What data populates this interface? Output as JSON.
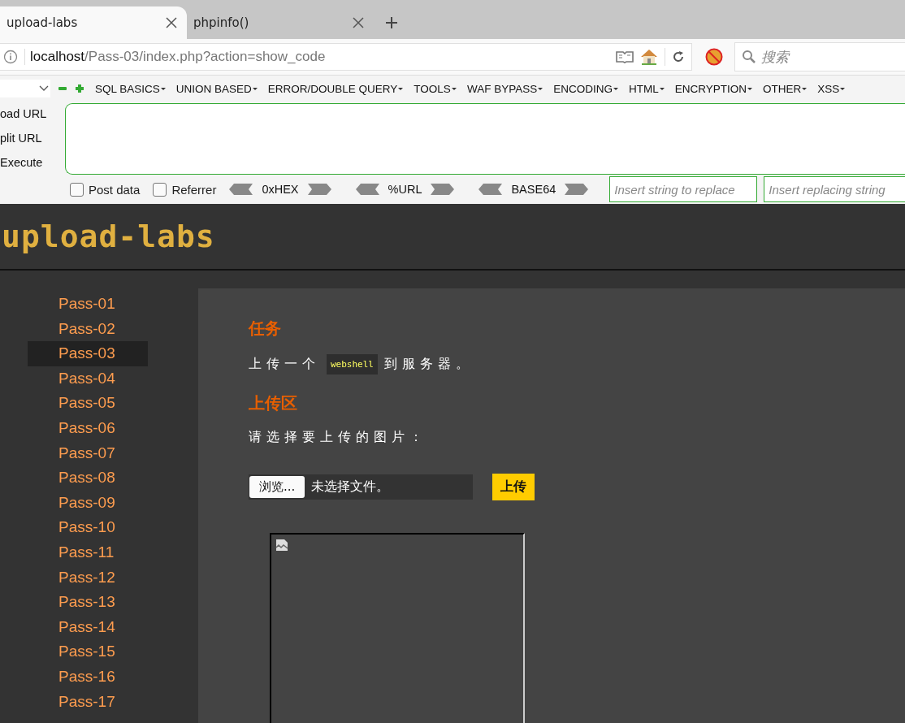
{
  "browser_tabs": [
    {
      "title": "upload-labs",
      "selected": true
    },
    {
      "title": "phpinfo()",
      "selected": false
    }
  ],
  "address": {
    "host": "localhost",
    "path": "/Pass-03/index.php?action=show_code"
  },
  "search": {
    "placeholder": "搜索"
  },
  "hackbar": {
    "menus": [
      "SQL BASICS",
      "UNION BASED",
      "ERROR/DOUBLE QUERY",
      "TOOLS",
      "WAF BYPASS",
      "ENCODING",
      "HTML",
      "ENCRYPTION",
      "OTHER",
      "XSS"
    ],
    "actions": [
      "oad URL",
      "plit URL",
      "Execute"
    ],
    "options": [
      {
        "label": "Post data",
        "checked": false
      },
      {
        "label": "Referrer",
        "checked": false
      }
    ],
    "encoders": [
      "0xHEX",
      "%URL",
      "BASE64"
    ],
    "replace_fields": [
      {
        "placeholder": "Insert string to replace"
      },
      {
        "placeholder": "Insert replacing string"
      }
    ]
  },
  "header": {
    "logo": "upload-labs"
  },
  "sidebar": {
    "items": [
      {
        "label": "Pass-01",
        "selected": false
      },
      {
        "label": "Pass-02",
        "selected": false
      },
      {
        "label": "Pass-03",
        "selected": true
      },
      {
        "label": "Pass-04",
        "selected": false
      },
      {
        "label": "Pass-05",
        "selected": false
      },
      {
        "label": "Pass-06",
        "selected": false
      },
      {
        "label": "Pass-07",
        "selected": false
      },
      {
        "label": "Pass-08",
        "selected": false
      },
      {
        "label": "Pass-09",
        "selected": false
      },
      {
        "label": "Pass-10",
        "selected": false
      },
      {
        "label": "Pass-11",
        "selected": false
      },
      {
        "label": "Pass-12",
        "selected": false
      },
      {
        "label": "Pass-13",
        "selected": false
      },
      {
        "label": "Pass-14",
        "selected": false
      },
      {
        "label": "Pass-15",
        "selected": false
      },
      {
        "label": "Pass-16",
        "selected": false
      },
      {
        "label": "Pass-17",
        "selected": false
      }
    ]
  },
  "content": {
    "task_heading": "任务",
    "task_before": "上传一个",
    "task_code": "webshell",
    "task_after": "到服务器。",
    "upload_heading": "上传区",
    "prompt": "请选择要上传的图片：",
    "file_button": "浏览...",
    "file_status": "未选择文件。",
    "submit": "上传"
  }
}
